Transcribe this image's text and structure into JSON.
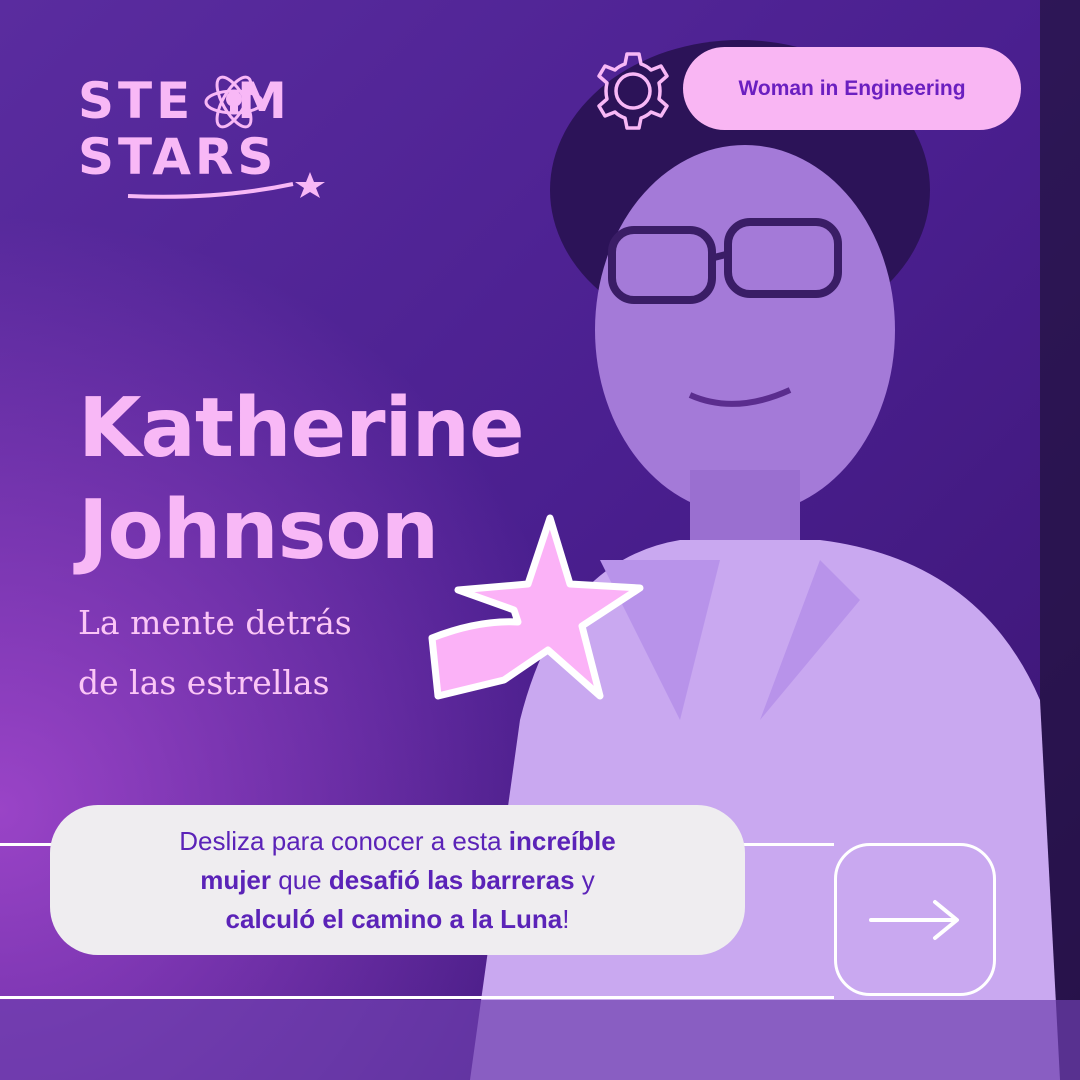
{
  "logo": {
    "line1": "STE  M",
    "line2": "STARS"
  },
  "badge": {
    "label": "Woman in Engineering"
  },
  "hero": {
    "name_line1": "Katherine",
    "name_line2": "Johnson",
    "subtitle_line1": "La mente detrás",
    "subtitle_line2": "de las estrellas"
  },
  "callout": {
    "seg1": "Desliza para conocer a esta ",
    "seg2": "increíble",
    "seg3": "mujer",
    "seg4": " que ",
    "seg5": "desafió las barreras",
    "seg6": " y",
    "seg7": "calculó el camino a la Luna",
    "seg8": "!"
  },
  "icons": {
    "logo_atom": "atom-lightbulb-icon",
    "gear": "gear-icon",
    "star": "shooting-star-icon",
    "arrow": "arrow-right-icon"
  },
  "colors": {
    "background": "#4a1f8f",
    "pink": "#f8b8f6",
    "badge_bg": "#f9b6f3",
    "accent_purple": "#6b1fc0",
    "callout_bg": "#efedf0"
  }
}
